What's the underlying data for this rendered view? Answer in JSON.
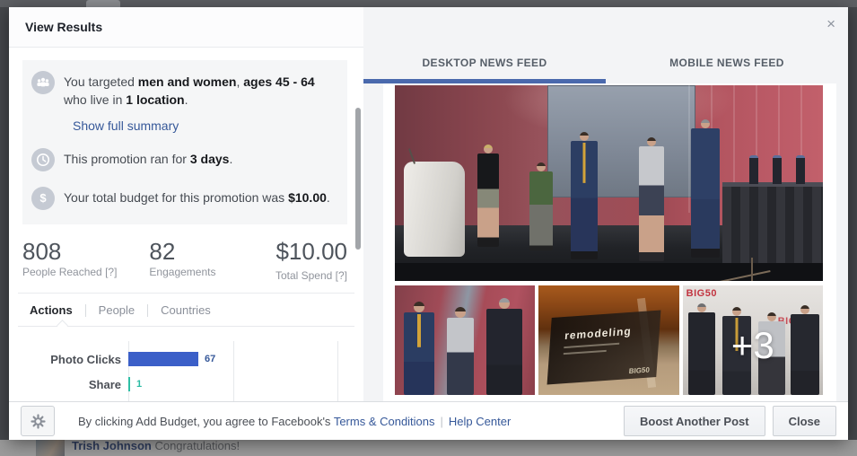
{
  "modal": {
    "title": "View Results",
    "close_icon": "×"
  },
  "summary": {
    "targeting": {
      "prefix": "You targeted ",
      "gender": "men and women",
      "sep1": ", ",
      "ages": "ages 45 - 64",
      "mid": " who live in ",
      "location": "1 location",
      "period": "."
    },
    "show_full_summary": "Show full summary",
    "duration": {
      "prefix": "This promotion ran for ",
      "bold": "3 days",
      "period": "."
    },
    "budget": {
      "prefix": "Your total budget for this promotion was ",
      "bold": "$10.00",
      "period": "."
    },
    "icons": [
      "people-group-icon",
      "clock-icon",
      "dollar-icon"
    ],
    "dollar_glyph": "$"
  },
  "stats": [
    {
      "value": "808",
      "label": "People Reached [?]"
    },
    {
      "value": "82",
      "label": "Engagements"
    },
    {
      "value": "$10.00",
      "label": "Total Spend [?]"
    }
  ],
  "insight_tabs": [
    {
      "label": "Actions",
      "active": true
    },
    {
      "label": "People",
      "active": false
    },
    {
      "label": "Countries",
      "active": false
    }
  ],
  "chart_data": {
    "type": "bar",
    "orientation": "horizontal",
    "categories": [
      "Photo Clicks",
      "Share"
    ],
    "values": [
      67,
      1
    ],
    "xlim": [
      0,
      200
    ],
    "grid": true,
    "bar_colors": [
      "#3b5fc8",
      "#2ebfa5"
    ],
    "value_colors": [
      "#365899",
      "#2abba4"
    ],
    "title": "",
    "xlabel": "",
    "ylabel": ""
  },
  "preview_tabs": [
    {
      "label": "DESKTOP NEWS FEED",
      "active": true
    },
    {
      "label": "MOBILE NEWS FEED",
      "active": false
    }
  ],
  "photo_collage": {
    "more_overlay": "+3",
    "award_text": "remodeling",
    "brand_text": "BIG50"
  },
  "footer": {
    "disclaimer_prefix": "By clicking Add Budget, you agree to Facebook's ",
    "terms_link": "Terms & Conditions",
    "separator": "|",
    "help_link": "Help Center",
    "boost_button": "Boost Another Post",
    "close_button": "Close"
  },
  "background": {
    "commenter": "Trish Johnson",
    "comment": " Congratulations!"
  },
  "colors": {
    "accent_blue": "#4a69ad",
    "link_blue": "#365899",
    "bar_blue": "#3b5fc8",
    "bar_teal": "#2ebfa5"
  }
}
